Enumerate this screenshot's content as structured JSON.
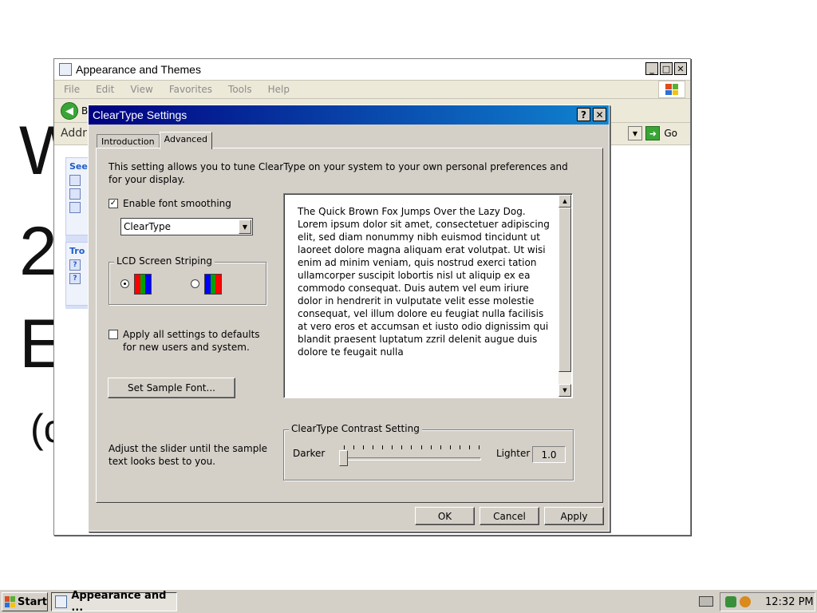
{
  "desktop_text": [
    "W",
    "2",
    "E",
    "(c"
  ],
  "main_window": {
    "title": "Appearance and Themes",
    "menu": [
      "File",
      "Edit",
      "View",
      "Favorites",
      "Tools",
      "Help"
    ],
    "back_label": "B",
    "address_label": "Addr",
    "go_label": "Go",
    "left_pane_heads": [
      "See",
      "Tro"
    ]
  },
  "dialog": {
    "title": "ClearType Settings",
    "help_label": "?",
    "close_label": "✕",
    "tabs": [
      "Introduction",
      "Advanced"
    ],
    "active_tab": "Advanced",
    "description": "This setting allows you to tune ClearType on your system to your own personal preferences and for your display.",
    "enable_smoothing": {
      "label": "Enable font smoothing",
      "checked": true
    },
    "smoothing_type": "ClearType",
    "lcd_group": {
      "legend": "LCD Screen Striping",
      "options": [
        {
          "order": "RGB",
          "selected": true,
          "colors": [
            "#ff0000",
            "#00a000",
            "#0000ff"
          ]
        },
        {
          "order": "BGR",
          "selected": false,
          "colors": [
            "#0000ff",
            "#00a000",
            "#ff0000"
          ]
        }
      ]
    },
    "apply_defaults": {
      "label": "Apply all settings to defaults for new users and system.",
      "checked": false
    },
    "set_sample_font_label": "Set Sample Font...",
    "sample_text": "The Quick Brown Fox Jumps Over the Lazy Dog. Lorem ipsum dolor sit amet, consectetuer adipiscing elit, sed diam nonummy nibh euismod tincidunt ut laoreet dolore magna aliquam erat volutpat. Ut wisi enim ad minim veniam, quis nostrud exerci tation ullamcorper suscipit lobortis nisl ut aliquip ex ea commodo consequat. Duis autem vel eum iriure dolor in hendrerit in vulputate velit esse molestie consequat, vel illum dolore eu feugiat nulla facilisis at vero eros et accumsan et iusto odio dignissim qui blandit praesent luptatum zzril delenit augue duis dolore te feugait nulla",
    "slider_hint": "Adjust the slider until the sample text looks best to you.",
    "contrast": {
      "legend": "ClearType Contrast Setting",
      "left_label": "Darker",
      "right_label": "Lighter",
      "value": "1.0"
    },
    "buttons": {
      "ok": "OK",
      "cancel": "Cancel",
      "apply": "Apply"
    }
  },
  "taskbar": {
    "start_label": "Start",
    "task_label": "Appearance and ...",
    "clock": "12:32 PM"
  }
}
